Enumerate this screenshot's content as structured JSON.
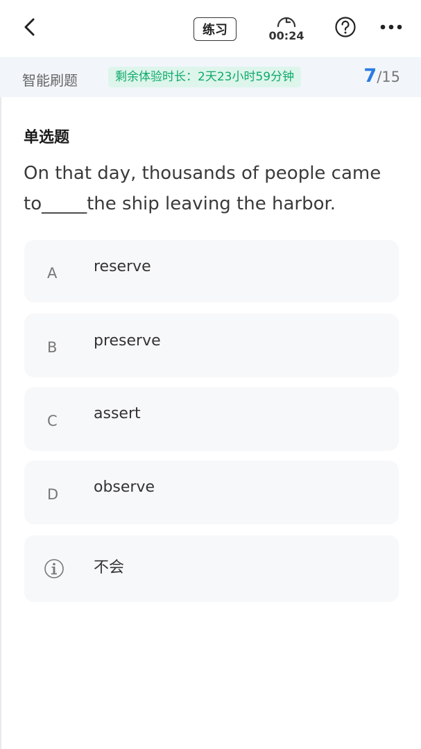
{
  "topbar": {
    "back_icon": "chevron-left-icon",
    "mode_label": "练习",
    "timer_icon": "stopwatch-icon",
    "timer_value": "00:24",
    "help_icon": "question-circle-icon",
    "more_icon": "more-dots-icon"
  },
  "infobar": {
    "title": "智能刷题",
    "trial_text": "剩余体验时长：2天23小时59分钟",
    "current": "7",
    "total": "/15",
    "accent": "#2b7be0",
    "trial_color": "#0eaa68"
  },
  "question": {
    "type": "单选题",
    "text": "On that day, thousands of people came to_____the ship leaving the harbor."
  },
  "options": [
    {
      "letter": "A",
      "text": "reserve"
    },
    {
      "letter": "B",
      "text": "preserve"
    },
    {
      "letter": "C",
      "text": "assert"
    },
    {
      "letter": "D",
      "text": "observe"
    }
  ],
  "dont_know": {
    "icon": "info-circle-icon",
    "text": "不会"
  }
}
